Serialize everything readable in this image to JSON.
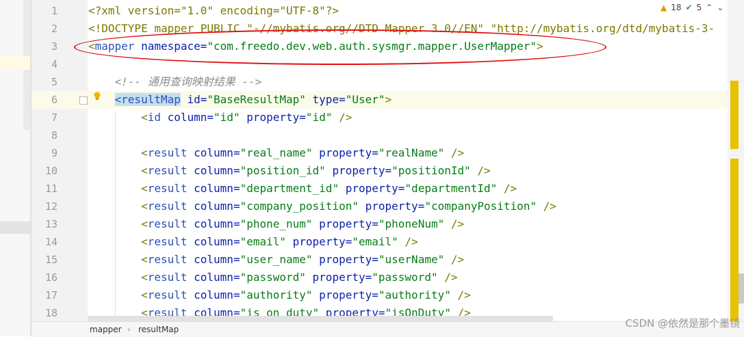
{
  "editor": {
    "lines": [
      {
        "n": "1",
        "parts": [
          {
            "t": "<?xml version=\"1.0\" encoding=\"UTF-8\"?>",
            "c": "t-br"
          }
        ]
      },
      {
        "n": "2",
        "parts": [
          {
            "t": "<!DOCTYPE mapper PUBLIC \"-//mybatis.org//DTD Mapper 3.0//EN\" \"http://mybatis.org/dtd/mybatis-3-",
            "c": "t-br"
          }
        ]
      },
      {
        "n": "3",
        "parts": [
          {
            "t": "<",
            "c": "t-br"
          },
          {
            "t": "mapper",
            "c": "t-tag"
          },
          {
            "t": " namespace",
            "c": "t-attr"
          },
          {
            "t": "=",
            "c": "t-attr"
          },
          {
            "t": "\"com.freedo.dev.web.auth.sysmgr.mapper.UserMapper\"",
            "c": "t-val"
          },
          {
            "t": ">",
            "c": "t-br"
          }
        ]
      },
      {
        "n": "4",
        "parts": []
      },
      {
        "n": "5",
        "parts": [
          {
            "t": "    <!-- 通用查询映射结果 -->",
            "c": "t-com"
          }
        ]
      },
      {
        "n": "6",
        "parts": [
          {
            "t": "    ",
            "c": ""
          },
          {
            "t": "<resultMap",
            "c": "t-tag tag-hl"
          },
          {
            "t": " id",
            "c": "t-attr"
          },
          {
            "t": "=",
            "c": "t-attr"
          },
          {
            "t": "\"BaseResultMap\"",
            "c": "t-val"
          },
          {
            "t": " type",
            "c": "t-attr"
          },
          {
            "t": "=",
            "c": "t-attr"
          },
          {
            "t": "\"User\"",
            "c": "t-val"
          },
          {
            "t": ">",
            "c": "t-br"
          }
        ]
      },
      {
        "n": "7",
        "parts": [
          {
            "t": "        <",
            "c": "t-br"
          },
          {
            "t": "id",
            "c": "t-tag"
          },
          {
            "t": " column",
            "c": "t-attr"
          },
          {
            "t": "=",
            "c": "t-attr"
          },
          {
            "t": "\"id\"",
            "c": "t-val"
          },
          {
            "t": " property",
            "c": "t-attr"
          },
          {
            "t": "=",
            "c": "t-attr"
          },
          {
            "t": "\"id\"",
            "c": "t-val"
          },
          {
            "t": " />",
            "c": "t-br"
          }
        ]
      },
      {
        "n": "8",
        "parts": []
      },
      {
        "n": "9",
        "parts": [
          {
            "t": "        <",
            "c": "t-br"
          },
          {
            "t": "result",
            "c": "t-tag"
          },
          {
            "t": " column",
            "c": "t-attr"
          },
          {
            "t": "=",
            "c": "t-attr"
          },
          {
            "t": "\"real_name\"",
            "c": "t-val"
          },
          {
            "t": " property",
            "c": "t-attr"
          },
          {
            "t": "=",
            "c": "t-attr"
          },
          {
            "t": "\"realName\"",
            "c": "t-val"
          },
          {
            "t": " />",
            "c": "t-br"
          }
        ]
      },
      {
        "n": "10",
        "parts": [
          {
            "t": "        <",
            "c": "t-br"
          },
          {
            "t": "result",
            "c": "t-tag"
          },
          {
            "t": " column",
            "c": "t-attr"
          },
          {
            "t": "=",
            "c": "t-attr"
          },
          {
            "t": "\"position_id\"",
            "c": "t-val"
          },
          {
            "t": " property",
            "c": "t-attr"
          },
          {
            "t": "=",
            "c": "t-attr"
          },
          {
            "t": "\"positionId\"",
            "c": "t-val"
          },
          {
            "t": " />",
            "c": "t-br"
          }
        ]
      },
      {
        "n": "11",
        "parts": [
          {
            "t": "        <",
            "c": "t-br"
          },
          {
            "t": "result",
            "c": "t-tag"
          },
          {
            "t": " column",
            "c": "t-attr"
          },
          {
            "t": "=",
            "c": "t-attr"
          },
          {
            "t": "\"department_id\"",
            "c": "t-val"
          },
          {
            "t": " property",
            "c": "t-attr"
          },
          {
            "t": "=",
            "c": "t-attr"
          },
          {
            "t": "\"departmentId\"",
            "c": "t-val"
          },
          {
            "t": " />",
            "c": "t-br"
          }
        ]
      },
      {
        "n": "12",
        "parts": [
          {
            "t": "        <",
            "c": "t-br"
          },
          {
            "t": "result",
            "c": "t-tag"
          },
          {
            "t": " column",
            "c": "t-attr"
          },
          {
            "t": "=",
            "c": "t-attr"
          },
          {
            "t": "\"company_position\"",
            "c": "t-val"
          },
          {
            "t": " property",
            "c": "t-attr"
          },
          {
            "t": "=",
            "c": "t-attr"
          },
          {
            "t": "\"companyPosition\"",
            "c": "t-val"
          },
          {
            "t": " />",
            "c": "t-br"
          }
        ]
      },
      {
        "n": "13",
        "parts": [
          {
            "t": "        <",
            "c": "t-br"
          },
          {
            "t": "result",
            "c": "t-tag"
          },
          {
            "t": " column",
            "c": "t-attr"
          },
          {
            "t": "=",
            "c": "t-attr"
          },
          {
            "t": "\"phone_num\"",
            "c": "t-val"
          },
          {
            "t": " property",
            "c": "t-attr"
          },
          {
            "t": "=",
            "c": "t-attr"
          },
          {
            "t": "\"phoneNum\"",
            "c": "t-val"
          },
          {
            "t": " />",
            "c": "t-br"
          }
        ]
      },
      {
        "n": "14",
        "parts": [
          {
            "t": "        <",
            "c": "t-br"
          },
          {
            "t": "result",
            "c": "t-tag"
          },
          {
            "t": " column",
            "c": "t-attr"
          },
          {
            "t": "=",
            "c": "t-attr"
          },
          {
            "t": "\"email\"",
            "c": "t-val"
          },
          {
            "t": " property",
            "c": "t-attr"
          },
          {
            "t": "=",
            "c": "t-attr"
          },
          {
            "t": "\"email\"",
            "c": "t-val"
          },
          {
            "t": " />",
            "c": "t-br"
          }
        ]
      },
      {
        "n": "15",
        "parts": [
          {
            "t": "        <",
            "c": "t-br"
          },
          {
            "t": "result",
            "c": "t-tag"
          },
          {
            "t": " column",
            "c": "t-attr"
          },
          {
            "t": "=",
            "c": "t-attr"
          },
          {
            "t": "\"user_name\"",
            "c": "t-val"
          },
          {
            "t": " property",
            "c": "t-attr"
          },
          {
            "t": "=",
            "c": "t-attr"
          },
          {
            "t": "\"userName\"",
            "c": "t-val"
          },
          {
            "t": " />",
            "c": "t-br"
          }
        ]
      },
      {
        "n": "16",
        "parts": [
          {
            "t": "        <",
            "c": "t-br"
          },
          {
            "t": "result",
            "c": "t-tag"
          },
          {
            "t": " column",
            "c": "t-attr"
          },
          {
            "t": "=",
            "c": "t-attr"
          },
          {
            "t": "\"password\"",
            "c": "t-val"
          },
          {
            "t": " property",
            "c": "t-attr"
          },
          {
            "t": "=",
            "c": "t-attr"
          },
          {
            "t": "\"password\"",
            "c": "t-val"
          },
          {
            "t": " />",
            "c": "t-br"
          }
        ]
      },
      {
        "n": "17",
        "parts": [
          {
            "t": "        <",
            "c": "t-br"
          },
          {
            "t": "result",
            "c": "t-tag"
          },
          {
            "t": " column",
            "c": "t-attr"
          },
          {
            "t": "=",
            "c": "t-attr"
          },
          {
            "t": "\"authority\"",
            "c": "t-val"
          },
          {
            "t": " property",
            "c": "t-attr"
          },
          {
            "t": "=",
            "c": "t-attr"
          },
          {
            "t": "\"authority\"",
            "c": "t-val"
          },
          {
            "t": " />",
            "c": "t-br"
          }
        ]
      },
      {
        "n": "18",
        "parts": [
          {
            "t": "        <",
            "c": "t-br"
          },
          {
            "t": "result",
            "c": "t-tag"
          },
          {
            "t": " column",
            "c": "t-attr"
          },
          {
            "t": "=",
            "c": "t-attr"
          },
          {
            "t": "\"is_on_duty\"",
            "c": "t-val"
          },
          {
            "t": " property",
            "c": "t-attr"
          },
          {
            "t": "=",
            "c": "t-attr"
          },
          {
            "t": "\"isOnDuty\"",
            "c": "t-val"
          },
          {
            "t": " />",
            "c": "t-br"
          }
        ]
      }
    ],
    "current_line": "6"
  },
  "inspections": {
    "warnings_count": "18",
    "ok_count": "5",
    "warning_icon": "warning-triangle-icon",
    "ok_icon": "check-icon",
    "prev_icon": "chevron-up-icon",
    "next_icon": "chevron-down-icon"
  },
  "breadcrumb": {
    "items": [
      "mapper",
      "resultMap"
    ],
    "separator": "›"
  },
  "watermark": "CSDN @依然是那个墨镜",
  "colors": {
    "tag": "#2e4fb5",
    "attribute": "#0a1fa8",
    "string": "#067d17",
    "comment": "#8c8c8c",
    "annotation_oval": "#e01010",
    "marker": "#e6c200"
  }
}
